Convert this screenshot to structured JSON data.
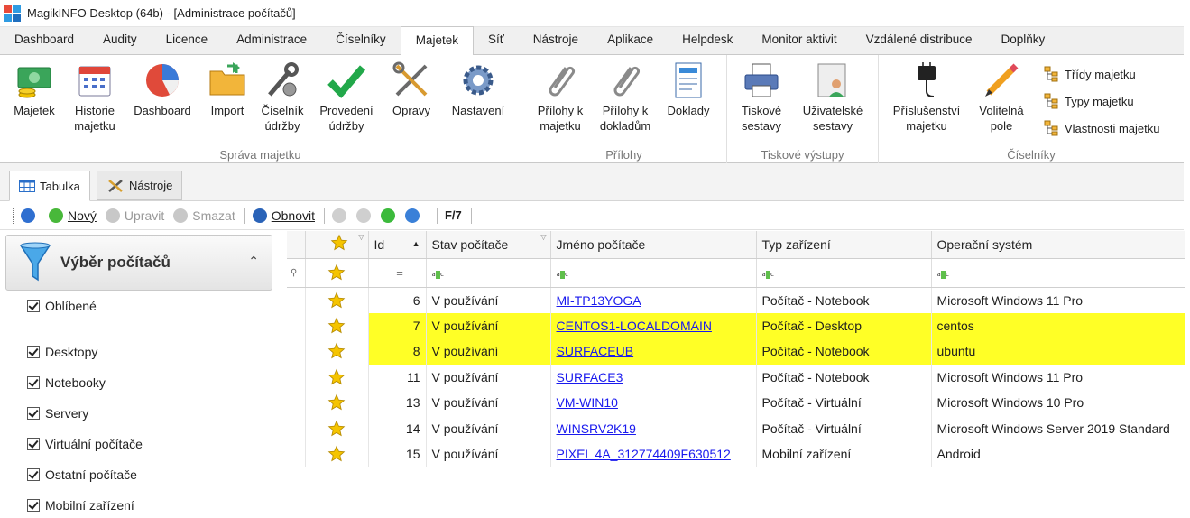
{
  "window": {
    "title": "MagikINFO Desktop (64b) - [Administrace počítačů]"
  },
  "menu": [
    "Dashboard",
    "Audity",
    "Licence",
    "Administrace",
    "Číselníky",
    "Majetek",
    "Síť",
    "Nástroje",
    "Aplikace",
    "Helpdesk",
    "Monitor aktivit",
    "Vzdálené distribuce",
    "Doplňky"
  ],
  "menu_active": "Majetek",
  "ribbon": {
    "sprava": {
      "label": "Správa majetku",
      "buttons": [
        {
          "l1": "Majetek",
          "l2": "",
          "icon": "money-icon"
        },
        {
          "l1": "Historie",
          "l2": "majetku",
          "icon": "calendar-icon"
        },
        {
          "l1": "Dashboard",
          "l2": "",
          "icon": "pie-chart-icon"
        },
        {
          "l1": "Import",
          "l2": "",
          "icon": "folder-icon"
        },
        {
          "l1": "Číselník",
          "l2": "údržby",
          "icon": "wrench-gear-icon"
        },
        {
          "l1": "Provedení",
          "l2": "údržby",
          "icon": "checkmark-icon"
        },
        {
          "l1": "Opravy",
          "l2": "",
          "icon": "tools-icon"
        },
        {
          "l1": "Nastavení",
          "l2": "",
          "icon": "gear-icon"
        }
      ]
    },
    "prilohy": {
      "label": "Přílohy",
      "buttons": [
        {
          "l1": "Přílohy k",
          "l2": "majetku",
          "icon": "paperclip-icon"
        },
        {
          "l1": "Přílohy k",
          "l2": "dokladům",
          "icon": "paperclip-icon"
        },
        {
          "l1": "Doklady",
          "l2": "",
          "icon": "document-icon"
        }
      ]
    },
    "tisk": {
      "label": "Tiskové výstupy",
      "buttons": [
        {
          "l1": "Tiskové",
          "l2": "sestavy",
          "icon": "printer-icon"
        },
        {
          "l1": "Uživatelské",
          "l2": "sestavy",
          "icon": "user-report-icon"
        }
      ]
    },
    "ciselniky": {
      "label": "Číselníky",
      "buttons": [
        {
          "l1": "Příslušenství",
          "l2": "majetku",
          "icon": "charger-icon"
        },
        {
          "l1": "Volitelná",
          "l2": "pole",
          "icon": "pencil-icon"
        }
      ],
      "small": [
        "Třídy majetku",
        "Typy majetku",
        "Vlastnosti majetku"
      ]
    }
  },
  "subtabs": [
    "Tabulka",
    "Nástroje"
  ],
  "toolbar": {
    "new": "Nový",
    "edit": "Upravit",
    "delete": "Smazat",
    "refresh": "Obnovit",
    "count": "F/7"
  },
  "left_panel": {
    "title": "Výběr počítačů",
    "filters": [
      "Oblíbené",
      "Desktopy",
      "Notebooky",
      "Servery",
      "Virtuální počítače",
      "Ostatní počítače",
      "Mobilní zařízení"
    ]
  },
  "grid": {
    "columns": [
      "Id",
      "Stav počítače",
      "Jméno počítače",
      "Typ zařízení",
      "Operační systém"
    ],
    "rows": [
      {
        "id": "6",
        "state": "V používání",
        "name": "MI-TP13YOGA",
        "type": "Počítač - Notebook",
        "os": "Microsoft Windows 11 Pro",
        "hl": false
      },
      {
        "id": "7",
        "state": "V používání",
        "name": "CENTOS1-LOCALDOMAIN",
        "type": "Počítač - Desktop",
        "os": "centos",
        "hl": true
      },
      {
        "id": "8",
        "state": "V používání",
        "name": "SURFACEUB",
        "type": "Počítač - Notebook",
        "os": "ubuntu",
        "hl": true
      },
      {
        "id": "11",
        "state": "V používání",
        "name": "SURFACE3",
        "type": "Počítač - Notebook",
        "os": "Microsoft Windows 11 Pro",
        "hl": false
      },
      {
        "id": "13",
        "state": "V používání",
        "name": "VM-WIN10",
        "type": "Počítač - Virtuální",
        "os": "Microsoft Windows 10 Pro",
        "hl": false
      },
      {
        "id": "14",
        "state": "V používání",
        "name": "WINSRV2K19",
        "type": "Počítač - Virtuální",
        "os": "Microsoft Windows Server 2019 Standard",
        "hl": false
      },
      {
        "id": "15",
        "state": "V používání",
        "name": "PIXEL 4A_312774409F630512",
        "type": "Mobilní zařízení",
        "os": "Android",
        "hl": false
      }
    ]
  },
  "colors": {
    "highlight": "#ffff26",
    "link": "#1a1aee",
    "star": "#f5c400"
  }
}
